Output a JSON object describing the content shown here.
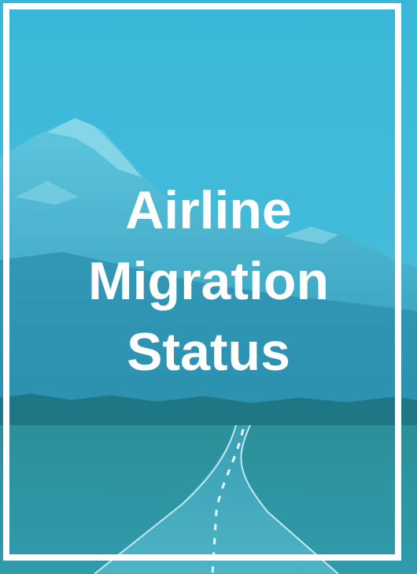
{
  "cover": {
    "title_lines": [
      "Airline",
      "Migration",
      "Status"
    ]
  },
  "colors": {
    "tint": "#36b3d3",
    "frame": "#ffffff",
    "text": "#ffffff"
  },
  "background": {
    "description_icon": "mountain-road-photo"
  }
}
